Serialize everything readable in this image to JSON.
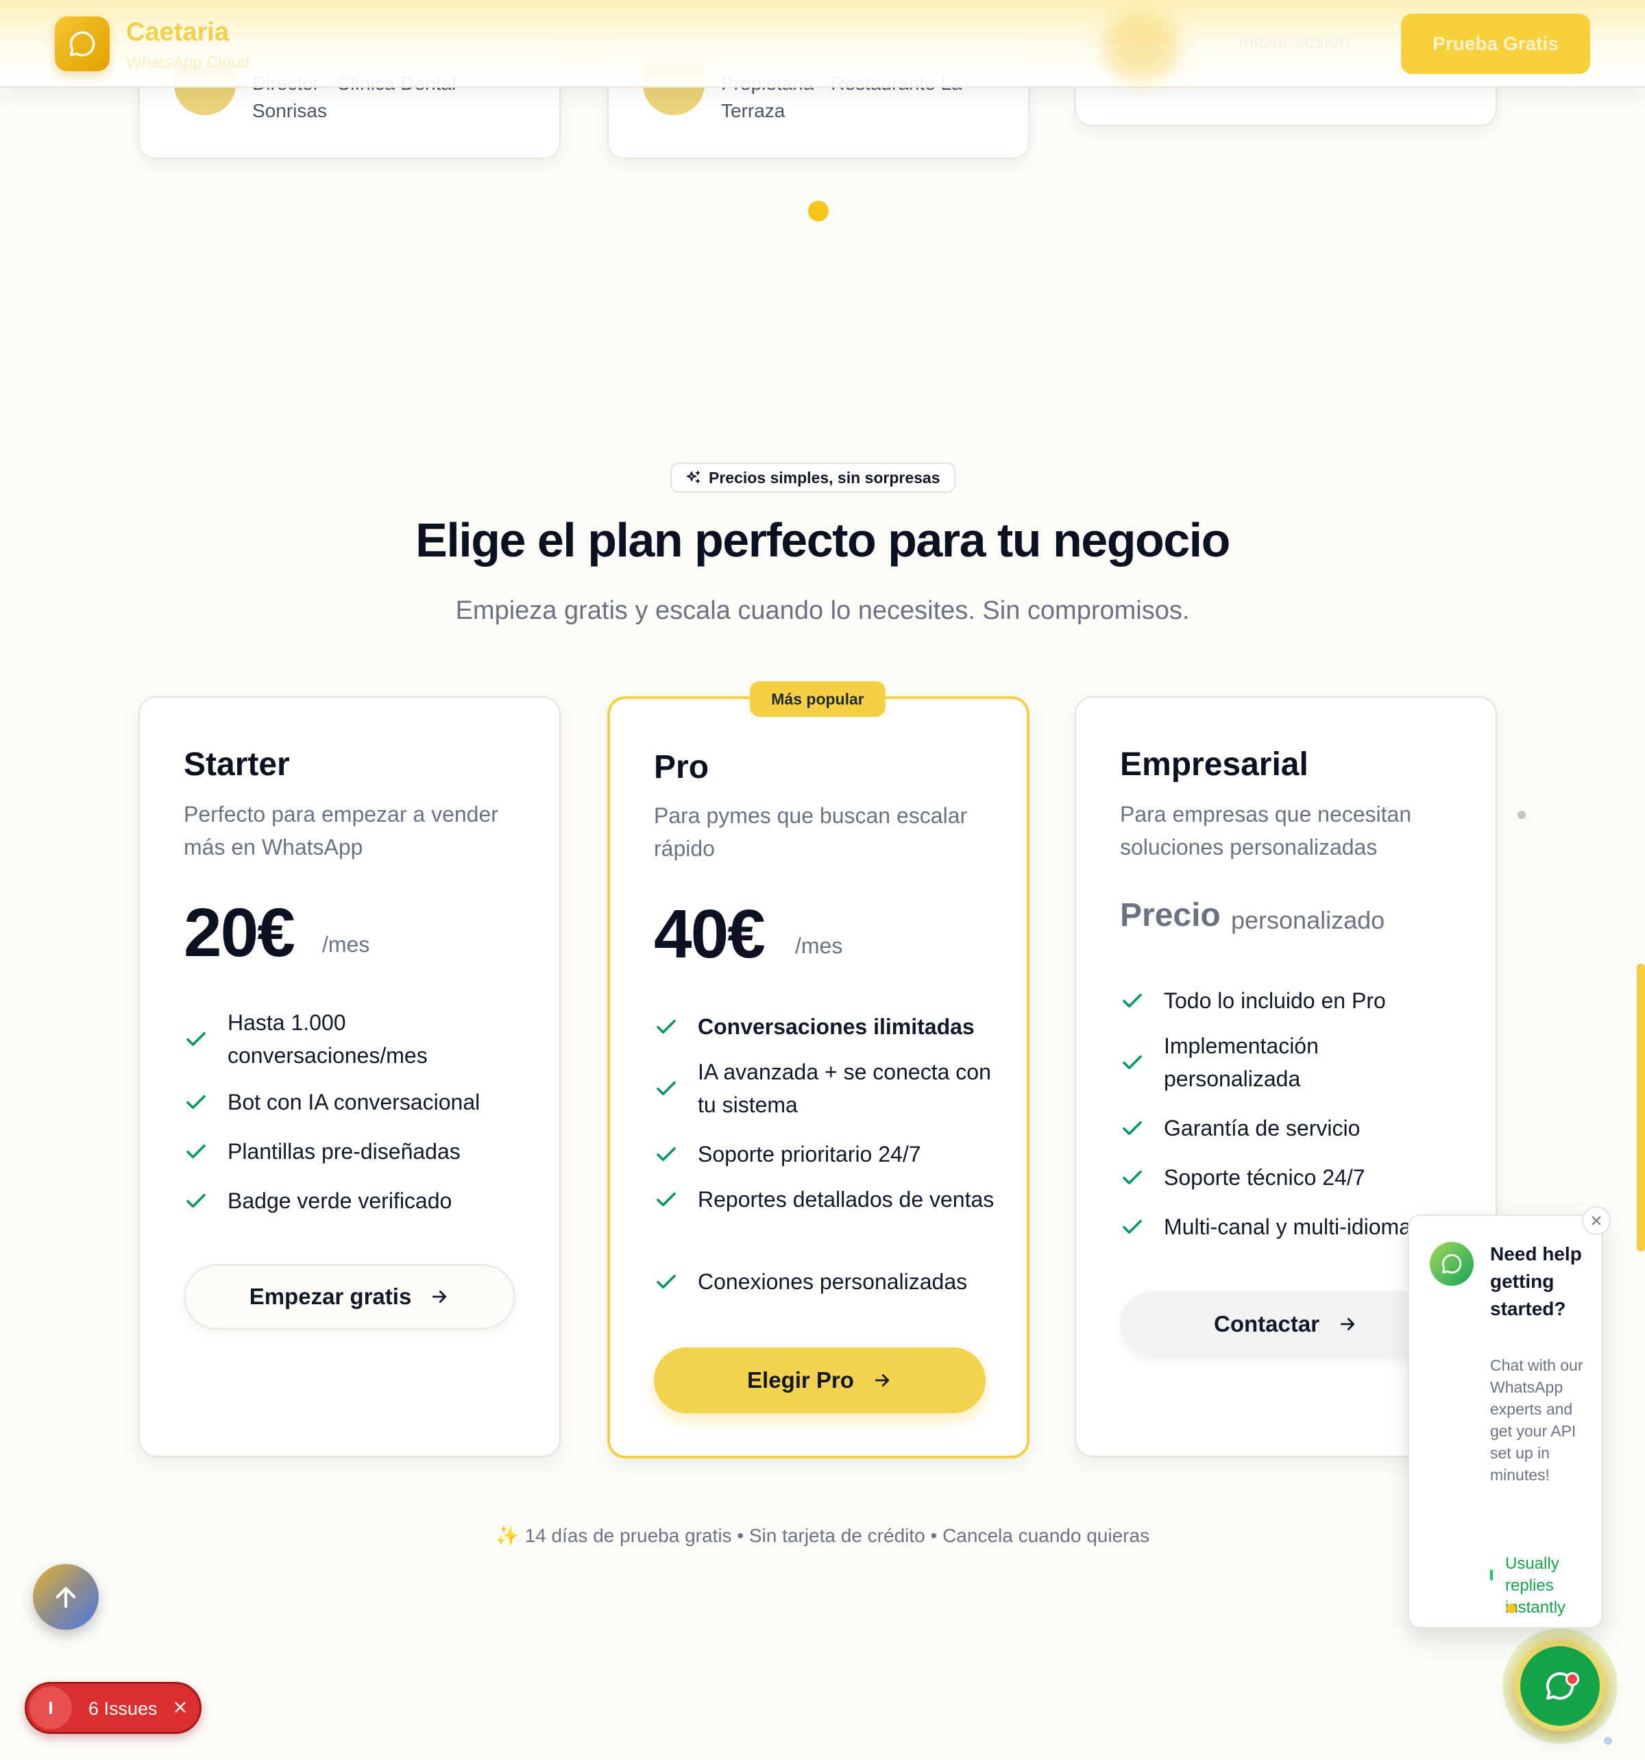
{
  "header": {
    "brand_name": "Caetaria",
    "brand_sub": "WhatsApp Cloud",
    "login": "Iniciar sesión",
    "trial_button": "Prueba Gratis"
  },
  "testimonials": [
    {
      "role_line1": "Director · Clínica Dental",
      "role_line2": "Sonrisas"
    },
    {
      "role_line1": "Propietaria · Restaurante La",
      "role_line2": "Terraza"
    }
  ],
  "pricing": {
    "badge": "Precios simples, sin sorpresas",
    "title": "Elige el plan perfecto para tu negocio",
    "subtitle": "Empieza gratis y escala cuando lo necesites. Sin compromisos.",
    "popular_badge": "Más popular",
    "plans": [
      {
        "name": "Starter",
        "description": "Perfecto para empezar a vender más en WhatsApp",
        "price": "20€",
        "period": "/mes",
        "features": [
          "Hasta 1.000 conversaciones/mes",
          "Bot con IA conversacional",
          "Plantillas pre-diseñadas",
          "Badge verde verificado"
        ],
        "cta": "Empezar gratis"
      },
      {
        "name": "Pro",
        "description": "Para pymes que buscan escalar rápido",
        "price": "40€",
        "period": "/mes",
        "features": [
          "Conversaciones ilimitadas",
          "IA avanzada + se conecta con tu sistema",
          "Soporte prioritario 24/7",
          "Reportes detallados de ventas",
          "Conexiones personalizadas"
        ],
        "cta": "Elegir Pro"
      },
      {
        "name": "Empresarial",
        "description": "Para empresas que necesitan soluciones personalizadas",
        "price": "Precio",
        "period": "personalizado",
        "features": [
          "Todo lo incluido en Pro",
          "Implementación personalizada",
          "Garantía de servicio",
          "Soporte técnico 24/7",
          "Multi-canal y multi-idioma"
        ],
        "cta": "Contactar"
      }
    ],
    "footnote": "✨ 14 días de prueba gratis • Sin tarjeta de crédito • Cancela cuando quieras"
  },
  "chat_widget": {
    "title": "Need help getting started?",
    "body": "Chat with our WhatsApp experts and get your API set up in minutes!",
    "status": "Usually replies instantly"
  },
  "issues_badge": {
    "count_initial": "I",
    "label": "6 Issues"
  },
  "colors": {
    "accent_yellow": "#f5d045",
    "check_green": "#059669",
    "chat_green": "#16a34a",
    "issues_red": "#d92f2f"
  }
}
